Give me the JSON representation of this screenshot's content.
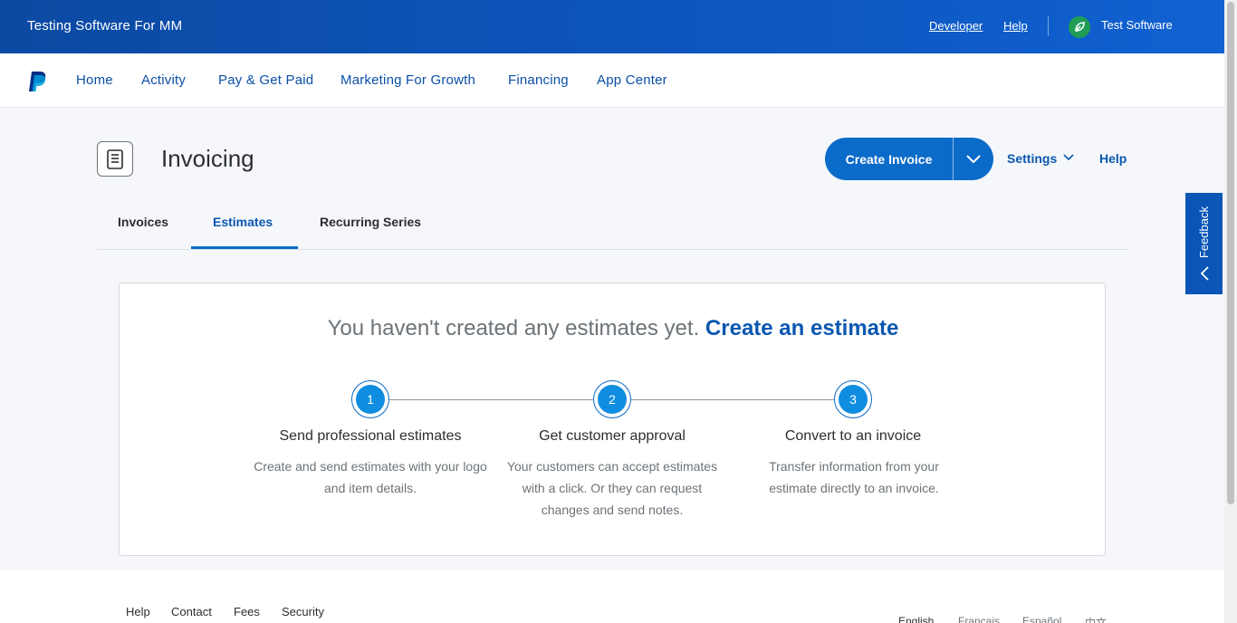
{
  "topbar": {
    "business_name": "Testing Software For MM",
    "developer": "Developer",
    "help": "Help",
    "user_name": "Test Software"
  },
  "nav": {
    "items": [
      "Home",
      "Activity",
      "Pay & Get Paid",
      "Marketing For Growth",
      "Financing",
      "App Center"
    ]
  },
  "header": {
    "title": "Invoicing",
    "create_invoice": "Create Invoice",
    "settings": "Settings",
    "help": "Help"
  },
  "tabs": {
    "items": [
      "Invoices",
      "Estimates",
      "Recurring Series"
    ],
    "active": "Estimates"
  },
  "empty_state": {
    "text": "You haven't created any estimates yet.",
    "cta": "Create an estimate",
    "steps": [
      {
        "number": "1",
        "title": "Send professional estimates",
        "desc": "Create and send estimates with your logo and item details."
      },
      {
        "number": "2",
        "title": "Get customer approval",
        "desc": "Your customers can accept estimates with a click. Or they can request changes and send notes."
      },
      {
        "number": "3",
        "title": "Convert to an invoice",
        "desc": "Transfer information from your estimate directly to an invoice."
      }
    ]
  },
  "feedback": "Feedback",
  "footer": {
    "links": [
      "Help",
      "Contact",
      "Fees",
      "Security"
    ],
    "languages": [
      "English",
      "Français",
      "Español",
      "中文"
    ]
  },
  "colors": {
    "brand_blue": "#0b6bc9",
    "link_blue": "#0b57b0",
    "topbar_blue": "#0d55bd"
  }
}
